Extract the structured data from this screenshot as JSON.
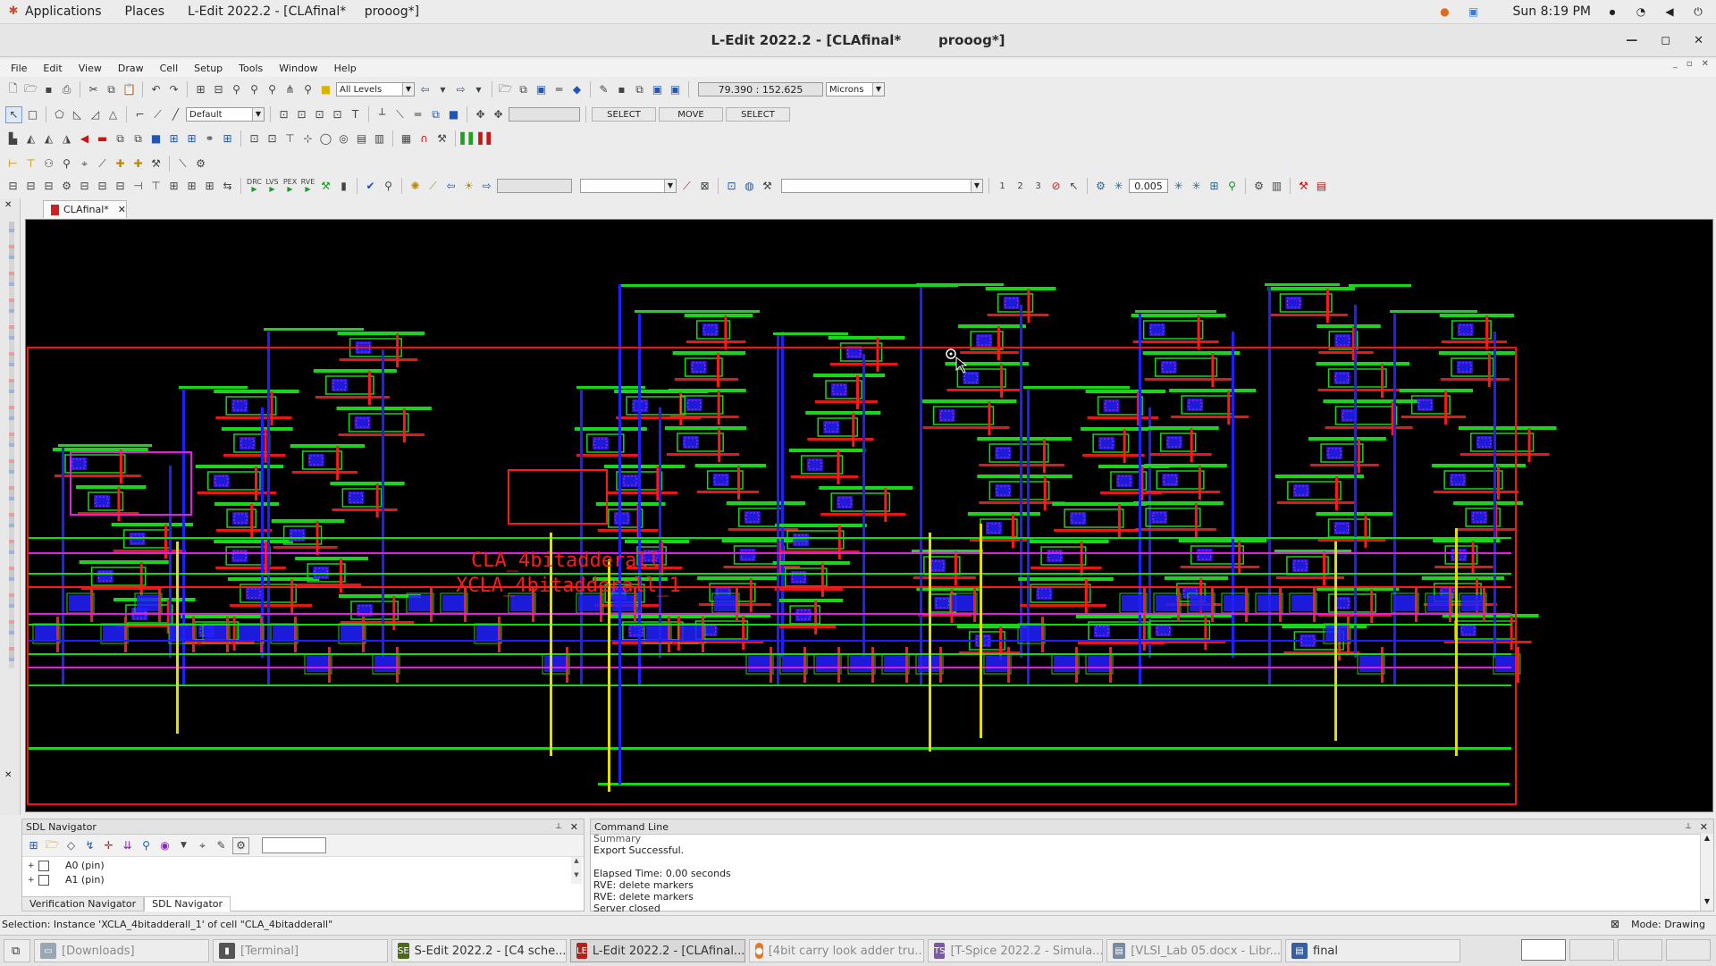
{
  "topbar": {
    "applications": "Applications",
    "places": "Places",
    "active_window": "L-Edit 2022.2 - [CLAfinal*",
    "active_window_sub": "prooog*]",
    "clock": "Sun  8:19 PM"
  },
  "window": {
    "title": "L-Edit 2022.2 - [CLAfinal*        prooog*]",
    "minimize_icon": "minimize-icon",
    "maximize_icon": "maximize-icon",
    "close_icon": "close-icon"
  },
  "menu": {
    "items": [
      "File",
      "Edit",
      "View",
      "Draw",
      "Cell",
      "Setup",
      "Tools",
      "Window",
      "Help"
    ]
  },
  "toolbar": {
    "levels_combo": "All Levels",
    "coords": "79.390 : 152.625",
    "units_combo": "Microns",
    "layer_combo": "Default",
    "mode_select_1": "SELECT",
    "mode_move": "MOVE",
    "mode_select_2": "SELECT",
    "drc_label": "DRC",
    "lvs_label": "LVS",
    "pex_label": "PEX",
    "rve_label": "RVE",
    "grid_value": "0.005"
  },
  "doc_tab": {
    "label": "CLAfinal*"
  },
  "canvas": {
    "cell_label_1": "CLA_4bitadderall",
    "cell_label_2": "XCLA_4bitadderall_1",
    "colors": {
      "background": "#000000",
      "boundary": "#ff1010",
      "metal1": "#2020ff",
      "poly": "#ff1a1a",
      "active": "#19d619",
      "metal2": "#e020e0",
      "metal3": "#e0e000"
    }
  },
  "sdl_navigator": {
    "title": "SDL Navigator",
    "tree": [
      {
        "label": "A0 (pin)"
      },
      {
        "label": "A1 (pin)"
      }
    ],
    "tabs": [
      "Verification Navigator",
      "SDL Navigator"
    ]
  },
  "command_line": {
    "title": "Command Line",
    "lines": [
      "Summary",
      "Export Successful.",
      "",
      "Elapsed Time: 0.00 seconds",
      "RVE: delete markers",
      "RVE: delete markers",
      "Server closed"
    ]
  },
  "status": {
    "selection": "Selection: Instance 'XCLA_4bitadderall_1' of cell \"CLA_4bitadderall\"",
    "mode": "Mode: Drawing"
  },
  "taskbar": {
    "items": [
      {
        "label": "[Downloads]",
        "icon": "folder-icon"
      },
      {
        "label": "[Terminal]",
        "icon": "terminal-icon"
      },
      {
        "label": "S-Edit 2022.2 - [C4 sche...",
        "icon": "sedit-icon"
      },
      {
        "label": "L-Edit 2022.2 - [CLAfinal...",
        "icon": "ledit-icon"
      },
      {
        "label": "[4bit carry look adder tru...",
        "icon": "browser-icon"
      },
      {
        "label": "[T-Spice 2022.2 - Simula...",
        "icon": "tspice-icon"
      },
      {
        "label": "[VLSI_Lab 05.docx - Libr...",
        "icon": "document-icon"
      },
      {
        "label": "final",
        "icon": "document-icon"
      }
    ]
  }
}
